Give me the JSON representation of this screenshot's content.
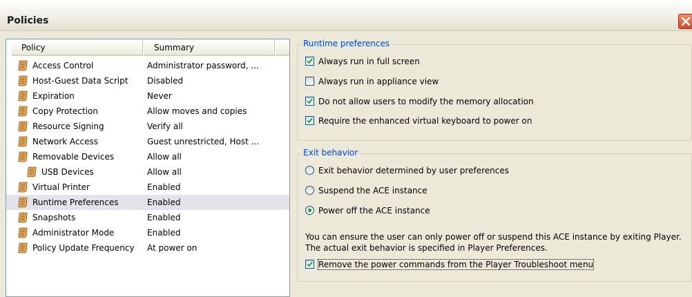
{
  "window": {
    "title": "Policies"
  },
  "policy_list": {
    "columns": [
      "Policy",
      "Summary"
    ],
    "rows": [
      {
        "name": "Access Control",
        "summary": "Administrator password, ..."
      },
      {
        "name": "Host-Guest Data Script",
        "summary": "Disabled"
      },
      {
        "name": "Expiration",
        "summary": "Never"
      },
      {
        "name": "Copy Protection",
        "summary": "Allow moves and copies"
      },
      {
        "name": "Resource Signing",
        "summary": "Verify all"
      },
      {
        "name": "Network Access",
        "summary": "Guest unrestricted, Host ..."
      },
      {
        "name": "Removable Devices",
        "summary": "Allow all"
      },
      {
        "name": "USB Devices",
        "summary": "Allow all",
        "child": true
      },
      {
        "name": "Virtual Printer",
        "summary": "Enabled"
      },
      {
        "name": "Runtime Preferences",
        "summary": "Enabled",
        "selected": true
      },
      {
        "name": "Snapshots",
        "summary": "Enabled"
      },
      {
        "name": "Administrator Mode",
        "summary": "Enabled"
      },
      {
        "name": "Policy Update Frequency",
        "summary": "At power on"
      }
    ]
  },
  "runtime_preferences": {
    "legend": "Runtime preferences",
    "options": [
      {
        "label": "Always run in full screen",
        "checked": true
      },
      {
        "label": "Always run in appliance view",
        "checked": false
      },
      {
        "label": "Do not allow users to modify the memory allocation",
        "checked": true
      },
      {
        "label": "Require the enhanced virtual keyboard to power on",
        "checked": true
      }
    ]
  },
  "exit_behavior": {
    "legend": "Exit behavior",
    "options": [
      {
        "label": "Exit behavior determined by user preferences",
        "selected": false
      },
      {
        "label": "Suspend the ACE instance",
        "selected": false
      },
      {
        "label": "Power off the ACE instance",
        "selected": true
      }
    ],
    "note": "You can ensure the user can only power off or suspend this ACE instance by exiting Player. The actual exit behavior is specified in Player Preferences.",
    "remove_power_commands": {
      "label": "Remove the power commands from the Player Troubleshoot menu",
      "checked": true
    }
  },
  "colors": {
    "legend": "#0046d5",
    "selected_row": "#e4e3eb",
    "radio_dot": "#21a121",
    "check": "#21a121"
  }
}
